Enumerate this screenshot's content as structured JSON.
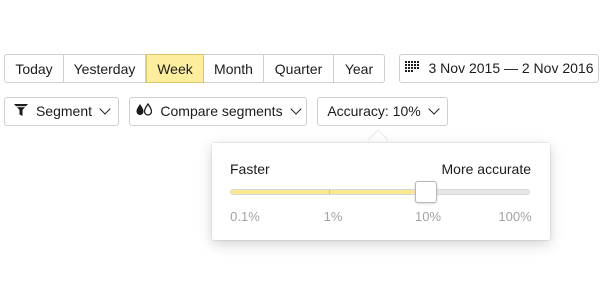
{
  "period_tabs": [
    "Today",
    "Yesterday",
    "Week",
    "Month",
    "Quarter",
    "Year"
  ],
  "active_period": "Week",
  "date_range": {
    "icon": "calendar-grid-icon",
    "label": "3 Nov 2015 — 2 Nov 2016"
  },
  "segment_button": {
    "icon": "filter-icon",
    "label": "Segment"
  },
  "compare_button": {
    "icon": "compare-drops-icon",
    "label": "Compare segments"
  },
  "accuracy_button": {
    "label": "Accuracy: 10%"
  },
  "accuracy_popup": {
    "left_label": "Faster",
    "right_label": "More accurate",
    "ticks": [
      "0.1%",
      "1%",
      "10%",
      "100%"
    ],
    "selected": "10%"
  },
  "colors": {
    "accent": "#fdee9e",
    "fill": "#fce98f"
  }
}
